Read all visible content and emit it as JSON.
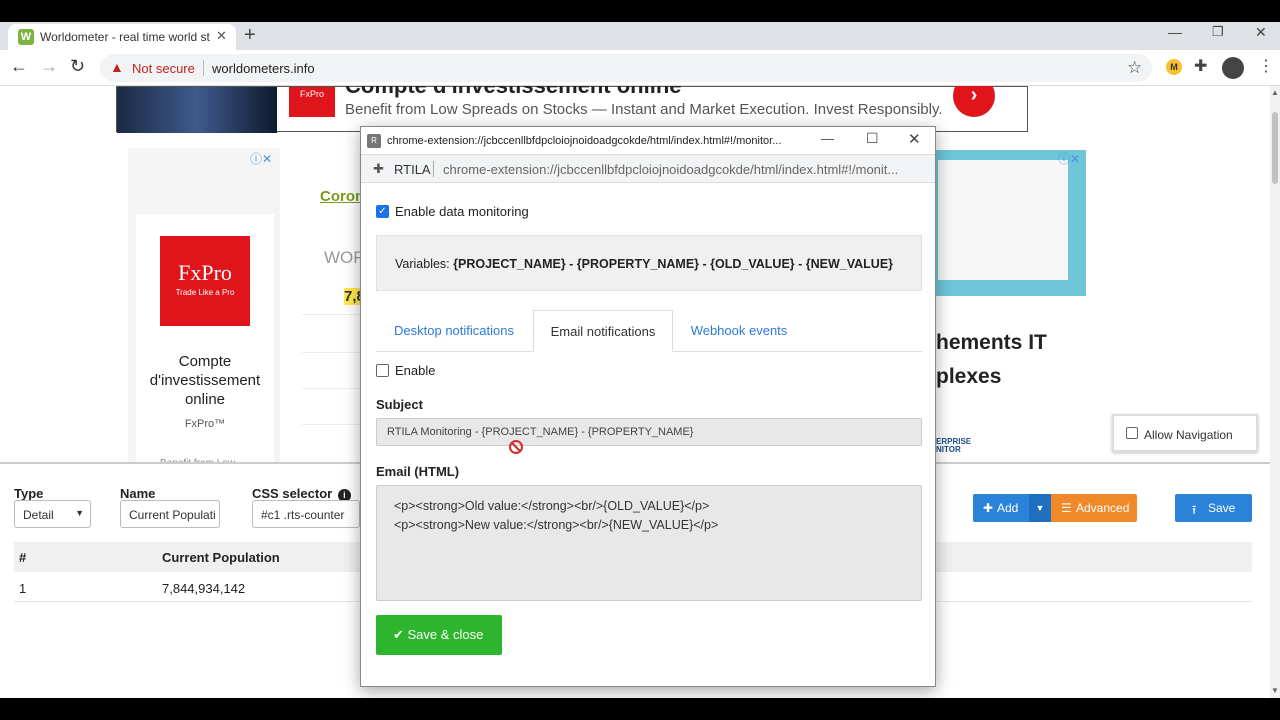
{
  "browser": {
    "tab_title": "Worldometer - real time world st",
    "tab_favicon": "W",
    "not_secure": "Not secure",
    "url": "worldometers.info"
  },
  "page": {
    "top_ad": {
      "logo": "FxPro",
      "title": "Compte d'investissement online",
      "subtitle": "Benefit from Low Spreads on Stocks — Instant and Market Execution. Invest Responsibly."
    },
    "side_ad": {
      "logo": "FxPro",
      "tagline": "Trade Like a Pro",
      "title": "Compte d'investissement online",
      "brand": "FxPro™",
      "cut_text": "Benefit from Low..."
    },
    "corona_link": "Coron",
    "wor_text": "WOR",
    "highlight_num": "7,8",
    "right_ad_text_1": "hements IT",
    "right_ad_text_2": "plexes",
    "right_ad_logo_1": "ERPRISE",
    "right_ad_logo_2": "NITOR",
    "allow_navigation": "Allow Navigation"
  },
  "bottom_panel": {
    "type_label": "Type",
    "type_value": "Detail",
    "name_label": "Name",
    "name_value": "Current Populati",
    "css_label": "CSS selector",
    "css_value": "#c1 .rts-counter",
    "add_label": "Add",
    "advanced_label": "Advanced",
    "save_label": "Save",
    "table": {
      "headers": [
        "#",
        "Current Population"
      ],
      "rows": [
        [
          "1",
          "7,844,934,142"
        ]
      ]
    }
  },
  "popup": {
    "window_title": "chrome-extension://jcbccenllbfdpcloiojnoidoadgcokde/html/index.html#!/monitor...",
    "ext_name": "RTILA",
    "url": "chrome-extension://jcbccenllbfdpcloiojnoidoadgcokde/html/index.html#!/monit...",
    "enable_monitoring": "Enable data monitoring",
    "variables_label": "Variables:",
    "variables_value": "{PROJECT_NAME} - {PROPERTY_NAME} - {OLD_VALUE} - {NEW_VALUE}",
    "tabs": [
      "Desktop notifications",
      "Email notifications",
      "Webhook events"
    ],
    "enable_label": "Enable",
    "subject_label": "Subject",
    "subject_value": "RTILA Monitoring - {PROJECT_NAME} - {PROPERTY_NAME}",
    "email_label": "Email (HTML)",
    "email_lines": [
      "<p><strong>Old value:</strong><br/>{OLD_VALUE}</p>",
      "<p><strong>New value:</strong><br/>{NEW_VALUE}</p>"
    ],
    "save_close": "Save & close"
  }
}
